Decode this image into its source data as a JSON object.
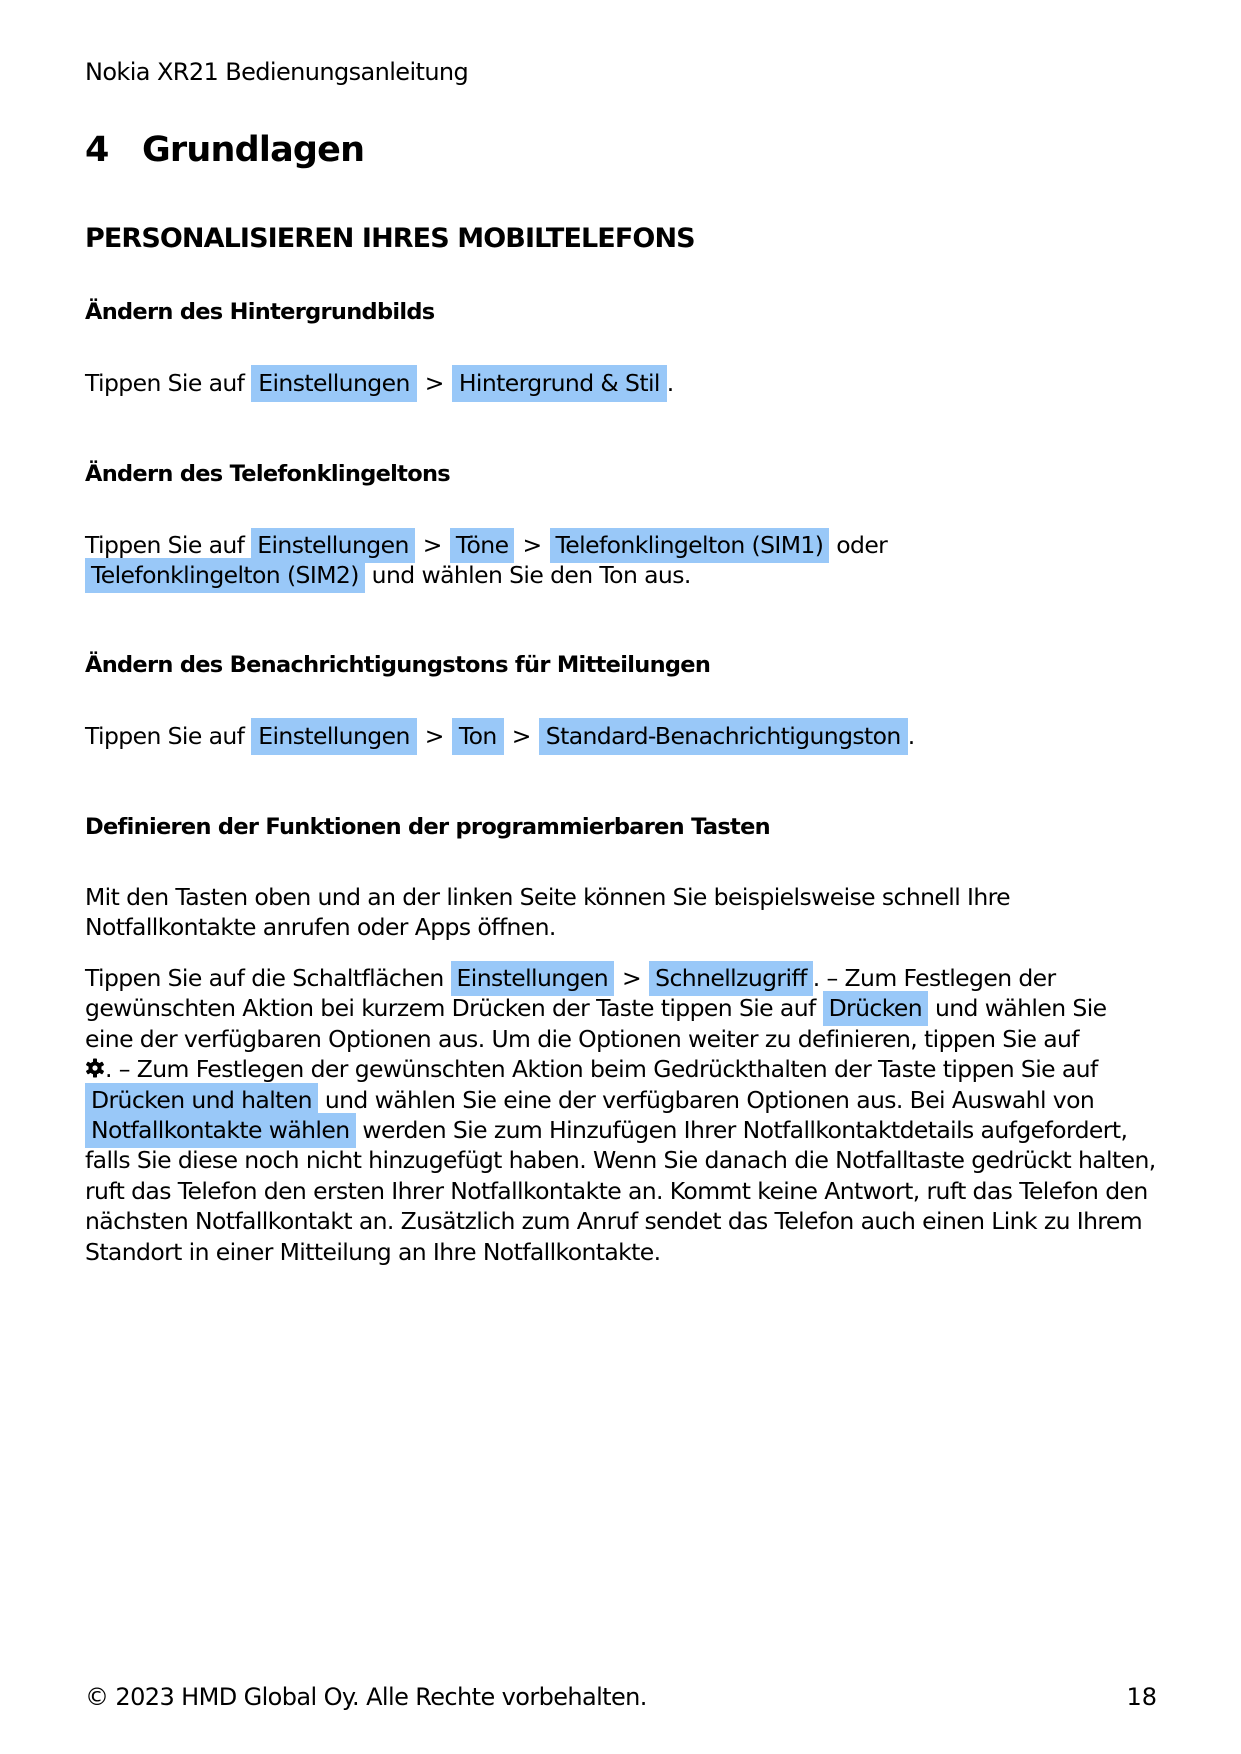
{
  "running_header": "Nokia XR21 Bedienungsanleitung",
  "chapter": {
    "number": "4",
    "title": "Grundlagen"
  },
  "section_title": "PERSONALISIEREN IHRES MOBILTELEFONS",
  "highlight_color": "#99c8f8",
  "separator": ">",
  "wallpaper": {
    "heading": "Ändern des Hintergrundbilds",
    "lead": "Tippen Sie auf",
    "path": [
      "Einstellungen",
      "Hintergrund & Stil"
    ],
    "end": "."
  },
  "ringtone": {
    "heading": "Ändern des Telefonklingeltons",
    "lead": "Tippen Sie auf",
    "path": [
      "Einstellungen",
      "Töne",
      "Telefonklingelton (SIM1)"
    ],
    "or": "oder",
    "alt": "Telefonklingelton (SIM2)",
    "tail": "und wählen Sie den Ton aus."
  },
  "notification": {
    "heading": "Ändern des Benachrichtigungstons für Mitteilungen",
    "lead": "Tippen Sie auf",
    "path": [
      "Einstellungen",
      "Ton",
      "Standard-Benachrichtigungston"
    ],
    "end": "."
  },
  "programmable_keys": {
    "heading": "Definieren der Funktionen der programmierbaren Tasten",
    "intro": "Mit den Tasten oben und an der linken Seite können Sie beispielsweise schnell Ihre Notfallkontakte anrufen oder Apps öffnen.",
    "body": {
      "t1": "Tippen Sie auf die Schaltflächen",
      "h1": "Einstellungen",
      "h2": "Schnellzugriff",
      "t2": ". – Zum Festlegen der gewünschten Aktion bei kurzem Drücken der Taste tippen Sie auf",
      "h3": "Drücken",
      "t3": "und wählen Sie eine der verfügbaren Optionen aus. Um die Optionen weiter zu definieren, tippen Sie auf",
      "icon": "gear-icon",
      "t4": ". – Zum Festlegen der gewünschten Aktion beim Gedrückthalten der Taste tippen Sie auf",
      "h4": "Drücken und halten",
      "t5": "und wählen Sie eine der verfügbaren Optionen aus. Bei Auswahl von",
      "h5": "Notfallkontakte wählen",
      "t6": "werden Sie zum Hinzufügen Ihrer Notfallkontaktdetails aufgefordert, falls Sie diese noch nicht hinzugefügt haben. Wenn Sie danach die Notfalltaste gedrückt halten, ruft das Telefon den ersten Ihrer Notfallkontakte an. Kommt keine Antwort, ruft das Telefon den nächsten Notfallkontakt an. Zusätzlich zum Anruf sendet das Telefon auch einen Link zu Ihrem Standort in einer Mitteilung an Ihre Notfallkontakte."
    }
  },
  "footer": {
    "copyright": "© 2023 HMD Global Oy. Alle Rechte vorbehalten.",
    "page_number": "18"
  }
}
